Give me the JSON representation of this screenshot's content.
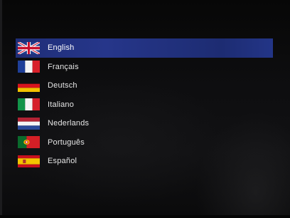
{
  "languages": [
    {
      "label": "English",
      "flag": "uk-flag-icon",
      "selected": true
    },
    {
      "label": "Français",
      "flag": "france-flag-icon",
      "selected": false
    },
    {
      "label": "Deutsch",
      "flag": "germany-flag-icon",
      "selected": false
    },
    {
      "label": "Italiano",
      "flag": "italy-flag-icon",
      "selected": false
    },
    {
      "label": "Nederlands",
      "flag": "netherlands-flag-icon",
      "selected": false
    },
    {
      "label": "Português",
      "flag": "portugal-flag-icon",
      "selected": false
    },
    {
      "label": "Español",
      "flag": "spain-flag-icon",
      "selected": false
    }
  ],
  "colors": {
    "background": "#0b0b0c",
    "selection": "#26368a",
    "text": "#e6e6e6"
  }
}
